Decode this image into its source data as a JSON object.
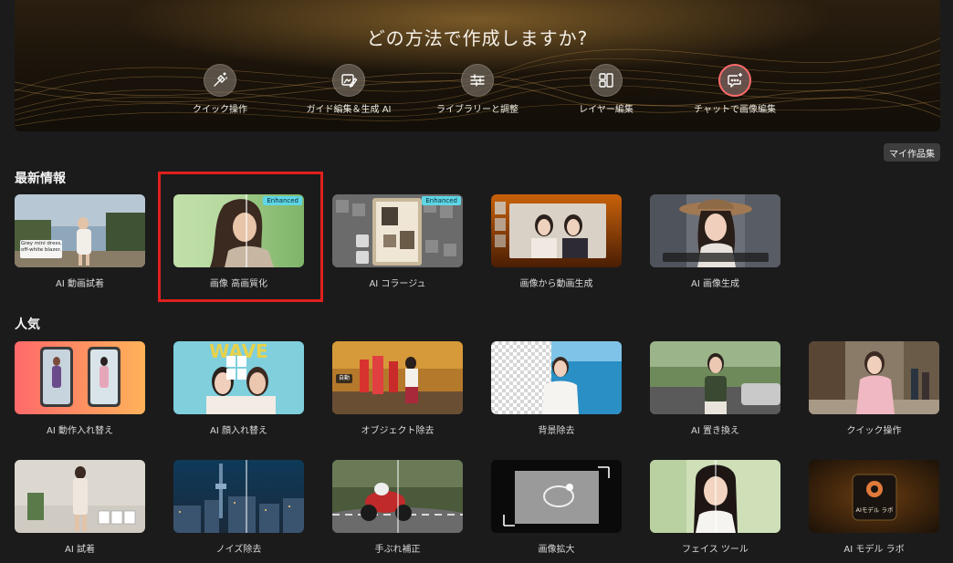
{
  "hero": {
    "title": "どの方法で作成しますか?",
    "modes": [
      {
        "label": "クイック操作",
        "icon": "magic-wand-icon"
      },
      {
        "label": "ガイド編集＆生成 AI",
        "icon": "image-edit-icon"
      },
      {
        "label": "ライブラリーと調整",
        "icon": "sliders-icon"
      },
      {
        "label": "レイヤー編集",
        "icon": "layers-icon"
      },
      {
        "label": "チャットで画像編集",
        "icon": "chat-sparkle-icon"
      }
    ]
  },
  "my_works_label": "マイ作品集",
  "latest": {
    "title": "最新情報",
    "cards": [
      {
        "caption": "AI 動画試着",
        "badge": "",
        "overlay": "Grey mini dress, off-white blazer."
      },
      {
        "caption": "画像 高画質化",
        "badge": "Enhanced"
      },
      {
        "caption": "AI コラージュ",
        "badge": "Enhanced"
      },
      {
        "caption": "画像から動画生成",
        "badge": ""
      },
      {
        "caption": "AI 画像生成",
        "badge": ""
      }
    ]
  },
  "popular": {
    "title": "人気",
    "cards": [
      {
        "caption": "AI 動作入れ替え"
      },
      {
        "caption": "AI 顔入れ替え",
        "overlay": "WAVE"
      },
      {
        "caption": "オブジェクト除去",
        "overlay": "自動"
      },
      {
        "caption": "背景除去"
      },
      {
        "caption": "AI 置き換え"
      },
      {
        "caption": "クイック操作"
      },
      {
        "caption": "AI 試着"
      },
      {
        "caption": "ノイズ除去"
      },
      {
        "caption": "手ぶれ補正"
      },
      {
        "caption": "画像拡大"
      },
      {
        "caption": "フェイス ツール"
      },
      {
        "caption": "AI モデル ラボ",
        "overlay": "AIモデル ラボ"
      }
    ]
  },
  "colors": {
    "accent_red": "#e0201d",
    "badge": "#5ed6e6",
    "background": "#1b1b1b"
  }
}
